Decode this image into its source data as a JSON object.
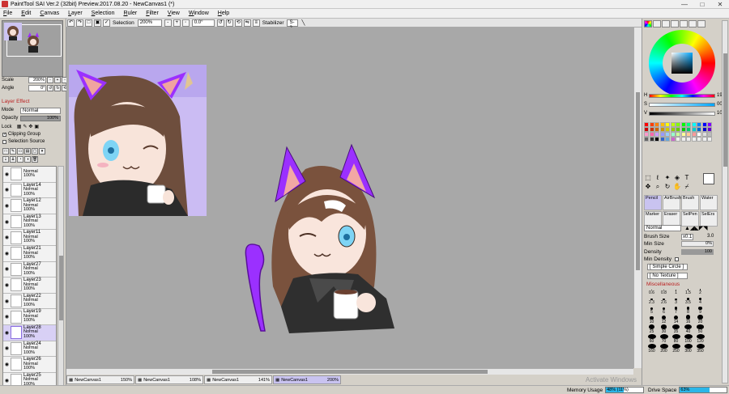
{
  "window": {
    "title": "PaintTool SAI Ver.2 (32bit) Preview.2017.08.20 - NewCanvas1 (*)",
    "minimize": "—",
    "maximize": "□",
    "close": "✕"
  },
  "menu": [
    "File",
    "Edit",
    "Canvas",
    "Layer",
    "Selection",
    "Ruler",
    "Filter",
    "View",
    "Window",
    "Help"
  ],
  "toolbar": {
    "selection_label": "Selection",
    "zoom": "200%",
    "angle": "0.0°",
    "stabilizer_label": "Stabilizer",
    "stabilizer_value": "S-2"
  },
  "navigator": {
    "scale_label": "Scale",
    "scale_value": "200%",
    "angle_label": "Angle",
    "angle_value": "0°"
  },
  "layer_effect": {
    "title": "Layer Effect",
    "mode_label": "Mode",
    "mode_value": "Normal",
    "opacity_label": "Opacity",
    "opacity_value": "100%",
    "lock_label": "Lock",
    "clipping_group": "Clipping Group",
    "selection_source": "Selection Source"
  },
  "layers": [
    {
      "name": "",
      "mode": "Normal",
      "opacity": "100%"
    },
    {
      "name": "Layer14",
      "mode": "Normal",
      "opacity": "100%"
    },
    {
      "name": "Layer12",
      "mode": "Normal",
      "opacity": "100%"
    },
    {
      "name": "Layer13",
      "mode": "Normal",
      "opacity": "100%"
    },
    {
      "name": "Layer11",
      "mode": "Normal",
      "opacity": "100%"
    },
    {
      "name": "Layer21",
      "mode": "Normal",
      "opacity": "100%"
    },
    {
      "name": "Layer27",
      "mode": "Normal",
      "opacity": "100%"
    },
    {
      "name": "Layer23",
      "mode": "Normal",
      "opacity": "100%"
    },
    {
      "name": "Layer22",
      "mode": "Normal",
      "opacity": "100%"
    },
    {
      "name": "Layer19",
      "mode": "Normal",
      "opacity": "100%"
    },
    {
      "name": "Layer28",
      "mode": "Normal",
      "opacity": "100%",
      "selected": true
    },
    {
      "name": "Layer24",
      "mode": "Normal",
      "opacity": "100%"
    },
    {
      "name": "Layer26",
      "mode": "Normal",
      "opacity": "100%"
    },
    {
      "name": "Layer25",
      "mode": "Normal",
      "opacity": "100%"
    }
  ],
  "canvas_tabs": [
    {
      "name": "NewCanvas1",
      "zoom": "150%"
    },
    {
      "name": "NewCanvas1",
      "zoom": "108%"
    },
    {
      "name": "NewCanvas1",
      "zoom": "141%"
    },
    {
      "name": "NewCanvas1",
      "zoom": "200%",
      "active": true
    }
  ],
  "status": {
    "memory_label": "Memory Usage",
    "memory_value": "48% (11%)",
    "memory_fraction": 0.48,
    "drive_label": "Drive Space",
    "drive_value": "63%",
    "drive_fraction": 0.63,
    "watermark": "Activate Windows"
  },
  "color": {
    "h_label": "H",
    "h_value": "194",
    "s_label": "S",
    "s_value": "000",
    "v_label": "V",
    "v_value": "100"
  },
  "brushes": [
    "Pencil",
    "AirBrush",
    "Brush",
    "Water",
    "Marker",
    "Eraser",
    "SelPen",
    "SelErs"
  ],
  "brush_props": {
    "mode": "Normal",
    "size_label": "Brush Size",
    "size_mult": "x0.1",
    "size_value": "3.0",
    "min_size_label": "Min Size",
    "min_size_value": "0%",
    "density_label": "Density",
    "density_value": "100",
    "min_density_label": "Min Density",
    "shape": "[ Simple Circle ]",
    "texture": "[ No Texture ]",
    "misc": "Miscellaneous"
  },
  "dot_sizes": [
    "0.6",
    "0.8",
    "1",
    "1.5",
    "2",
    "",
    "2.3",
    "2.6",
    "3",
    "3.5",
    "4",
    "",
    "5",
    "6",
    "7",
    "8",
    "9",
    "",
    "10",
    "12",
    "14",
    "16",
    "20",
    "",
    "25",
    "30",
    "35",
    "40",
    "50",
    "",
    "60",
    "70",
    "80",
    "100",
    "120",
    "",
    "160",
    "200",
    "250",
    "300",
    "350",
    ""
  ],
  "colors": {
    "selected_layer": "#d8d0f5",
    "active_tab": "#c9c3f0",
    "accent_red": "#b22222",
    "meter": "#2bb6e8"
  }
}
